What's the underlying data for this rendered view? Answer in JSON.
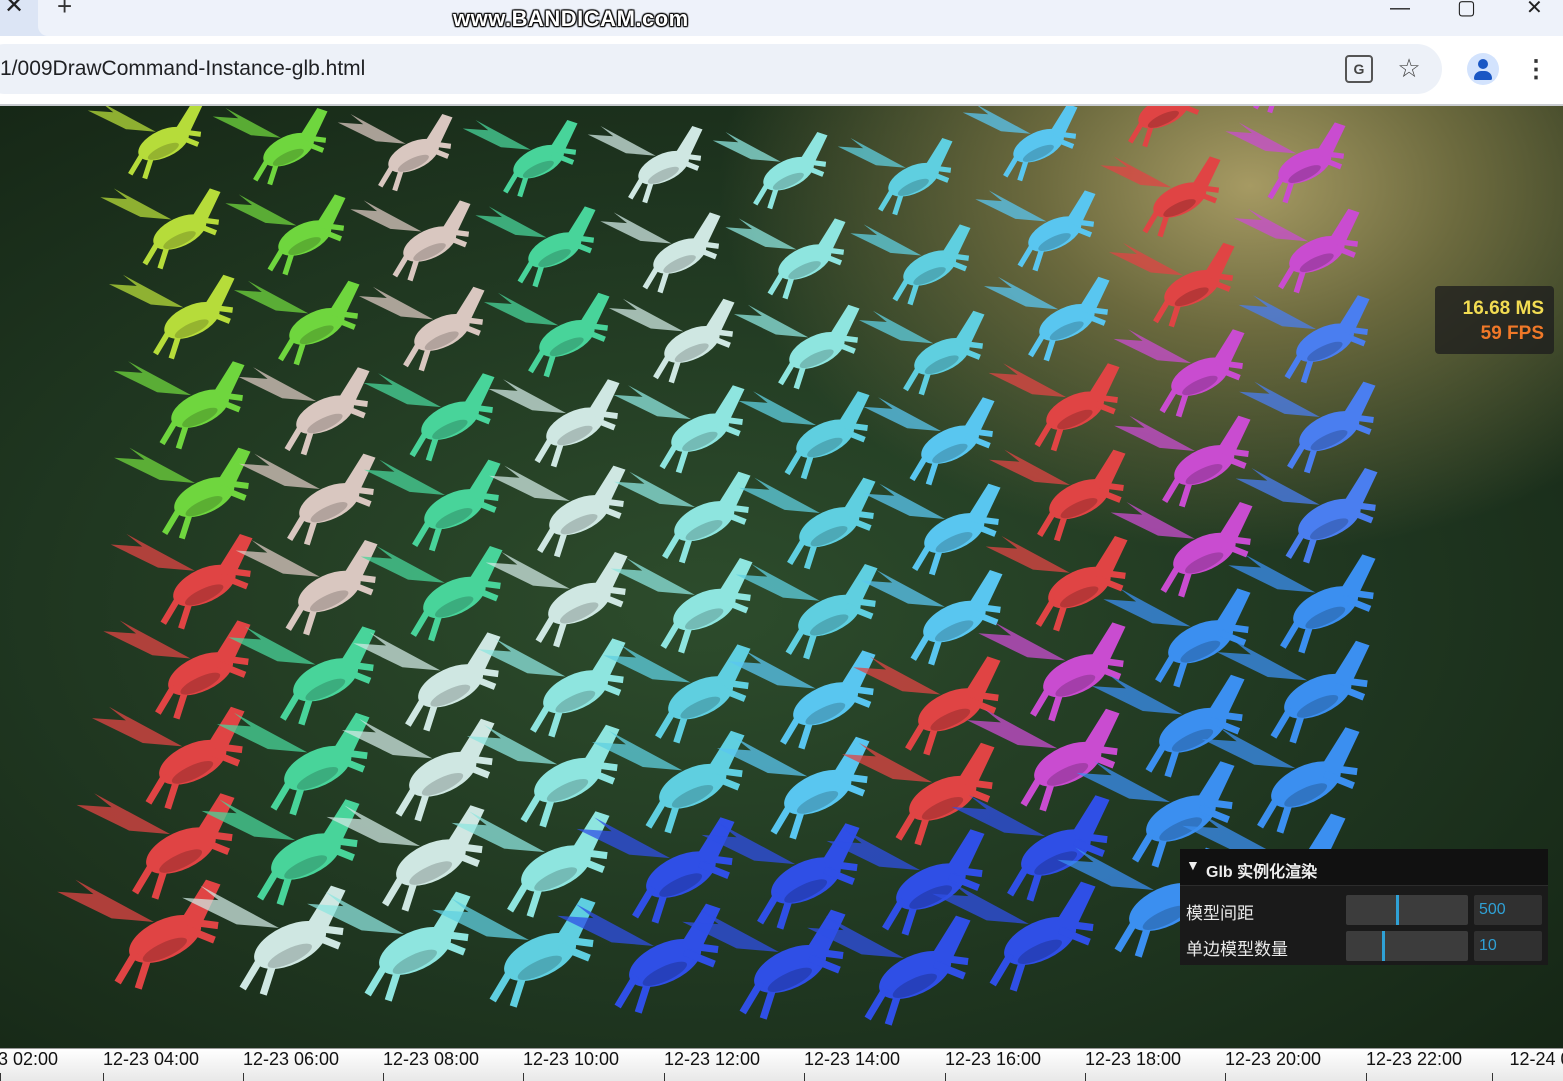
{
  "browser": {
    "watermark": "www.BANDICAM.com",
    "tab_close": "✕",
    "new_tab": "+",
    "url": "1/009DrawCommand-Instance-glb.html",
    "translate_glyph": "G",
    "star_glyph": "☆",
    "menu_glyph": "⋮",
    "window_controls": [
      "—",
      "▢",
      "✕"
    ]
  },
  "stats": {
    "ms": "16.68 MS",
    "fps": "59 FPS"
  },
  "gui": {
    "title": "Glb 实例化渲染",
    "rows": [
      {
        "label": "模型间距",
        "value": "500",
        "slider_fraction": 0.42
      },
      {
        "label": "单边模型数量",
        "value": "10",
        "slider_fraction": 0.3
      }
    ]
  },
  "timeline": {
    "ticks": [
      "3 02:00",
      "12-23 04:00",
      "12-23 06:00",
      "12-23 08:00",
      "12-23 10:00",
      "12-23 12:00",
      "12-23 14:00",
      "12-23 16:00",
      "12-23 18:00",
      "12-23 20:00",
      "12-23 22:00",
      "12-24 0"
    ]
  },
  "scene": {
    "model_color_columns": [
      "#b6dc3a",
      "#6fd63e",
      "#d9c7c0",
      "#48d49a",
      "#cfe7e2",
      "#8ee5df",
      "#5fcfe0",
      "#59c6f0",
      "#e04444",
      "#c94cd0",
      "#4a7ef0",
      "#1f3ee0"
    ]
  }
}
